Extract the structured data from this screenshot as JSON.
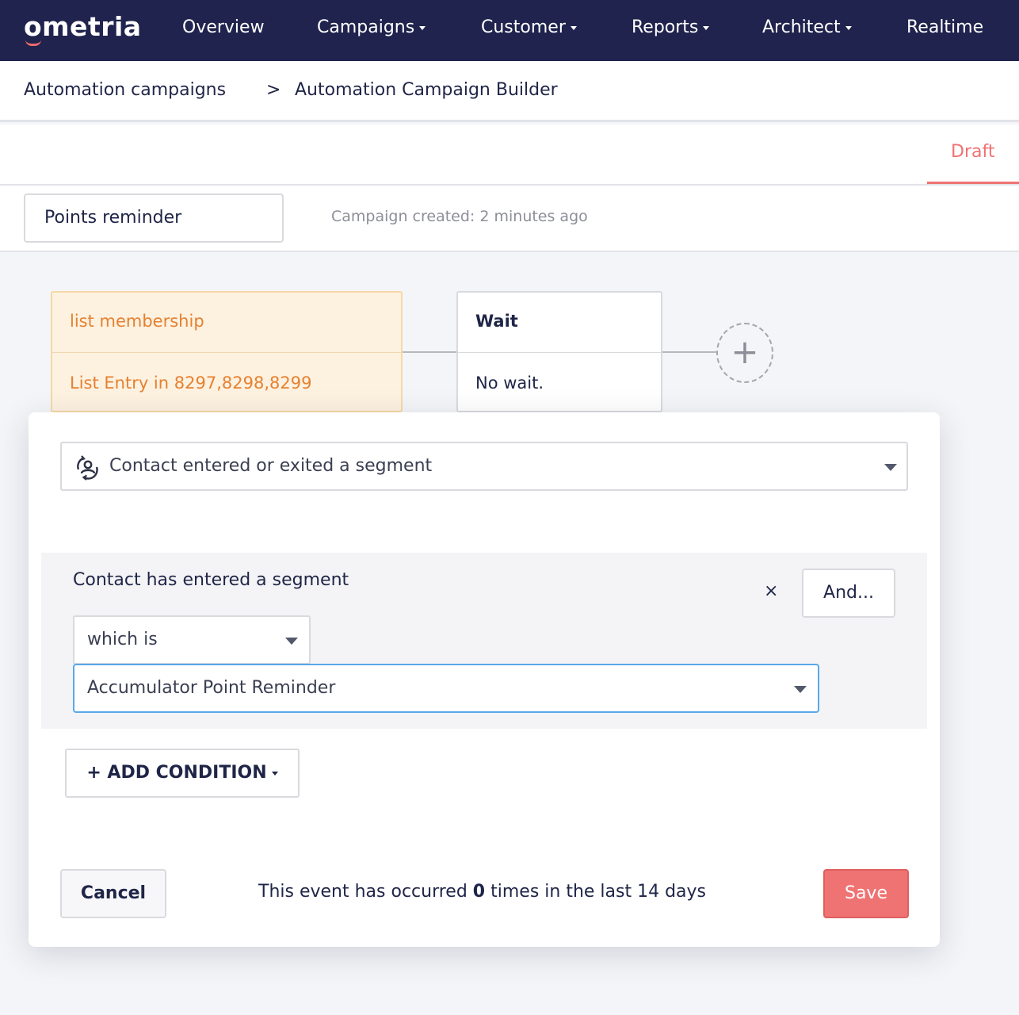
{
  "nav": {
    "logo": "ometria",
    "items": [
      {
        "label": "Overview",
        "dropdown": false
      },
      {
        "label": "Campaigns",
        "dropdown": true
      },
      {
        "label": "Customer",
        "dropdown": true
      },
      {
        "label": "Reports",
        "dropdown": true
      },
      {
        "label": "Architect",
        "dropdown": true
      },
      {
        "label": "Realtime",
        "dropdown": false
      }
    ]
  },
  "breadcrumb": {
    "parent": "Automation campaigns",
    "separator": ">",
    "current": "Automation Campaign Builder"
  },
  "status": {
    "label": "Draft",
    "color": "#ef7373"
  },
  "campaign": {
    "name": "Points reminder",
    "created": "Campaign created: 2 minutes ago"
  },
  "flow": {
    "trigger": {
      "title": "list membership",
      "detail": "List Entry in 8297,8298,8299"
    },
    "wait": {
      "title": "Wait",
      "detail": "No wait."
    },
    "add_node_icon": "plus-icon"
  },
  "modal": {
    "event_icon": "segment-icon",
    "event_type": "Contact entered or exited a segment",
    "condition": {
      "title": "Contact has entered a segment",
      "remove_symbol": "×",
      "and_label": "And...",
      "operator": "which is",
      "value": "Accumulator Point Reminder"
    },
    "add_condition_label": "+ ADD CONDITION",
    "cancel_label": "Cancel",
    "occurrence": {
      "prefix": "This event has occurred",
      "count": "0",
      "suffix": "times in the last 14 days"
    },
    "save_label": "Save"
  },
  "colors": {
    "nav_bg": "#20234d",
    "accent": "#ef7373",
    "trigger_bg": "#fdf1e0",
    "trigger_text": "#e5812f",
    "focus_border": "#5aa8ea"
  }
}
